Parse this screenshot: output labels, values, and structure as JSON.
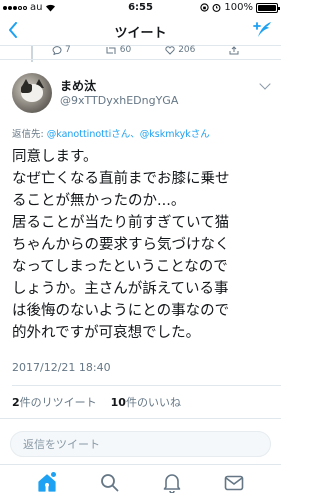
{
  "status_bar": {
    "carrier": "au",
    "time": "6:55",
    "battery": "100%"
  },
  "nav": {
    "back_icon": "chevron-left-icon",
    "title": "ツイート",
    "compose_icon": "compose-tweet-icon"
  },
  "previous_tweet": {
    "reply_count": "7",
    "retweet_count": "60",
    "like_count": "206"
  },
  "tweet": {
    "user_name": "まめ汰",
    "user_handle": "@9xTTDyxhEDngYGA",
    "reply_to_prefix": "返信先: ",
    "reply_to_mention_1": "@kanottinottiさん",
    "reply_to_separator": "、",
    "reply_to_mention_2": "@kskmkykさん",
    "body_lines": [
      "同意します。",
      "なぜ亡くなる直前までお膝に乗せ",
      "ることが無かったのか...。",
      "居ることが当たり前すぎていて猫",
      "ちゃんからの要求すら気づけなく",
      "なってしまったということなので",
      "しょうか。主さんが訴えている事",
      "は後悔のないようにとの事なので",
      "的外れですが可哀想でした。"
    ],
    "timestamp": "2017/12/21 18:40",
    "retweets_number": "2",
    "retweets_label": "件のリツイート",
    "likes_number": "10",
    "likes_label": "件のいいね"
  },
  "reply_input": {
    "placeholder": "返信をツイート"
  },
  "tab_bar": {
    "items": [
      "home-icon",
      "search-icon",
      "notifications-icon",
      "messages-icon"
    ]
  },
  "colors": {
    "accent": "#1da1f2",
    "text": "#14171a",
    "secondary": "#657786",
    "divider": "#e1e8ed"
  }
}
